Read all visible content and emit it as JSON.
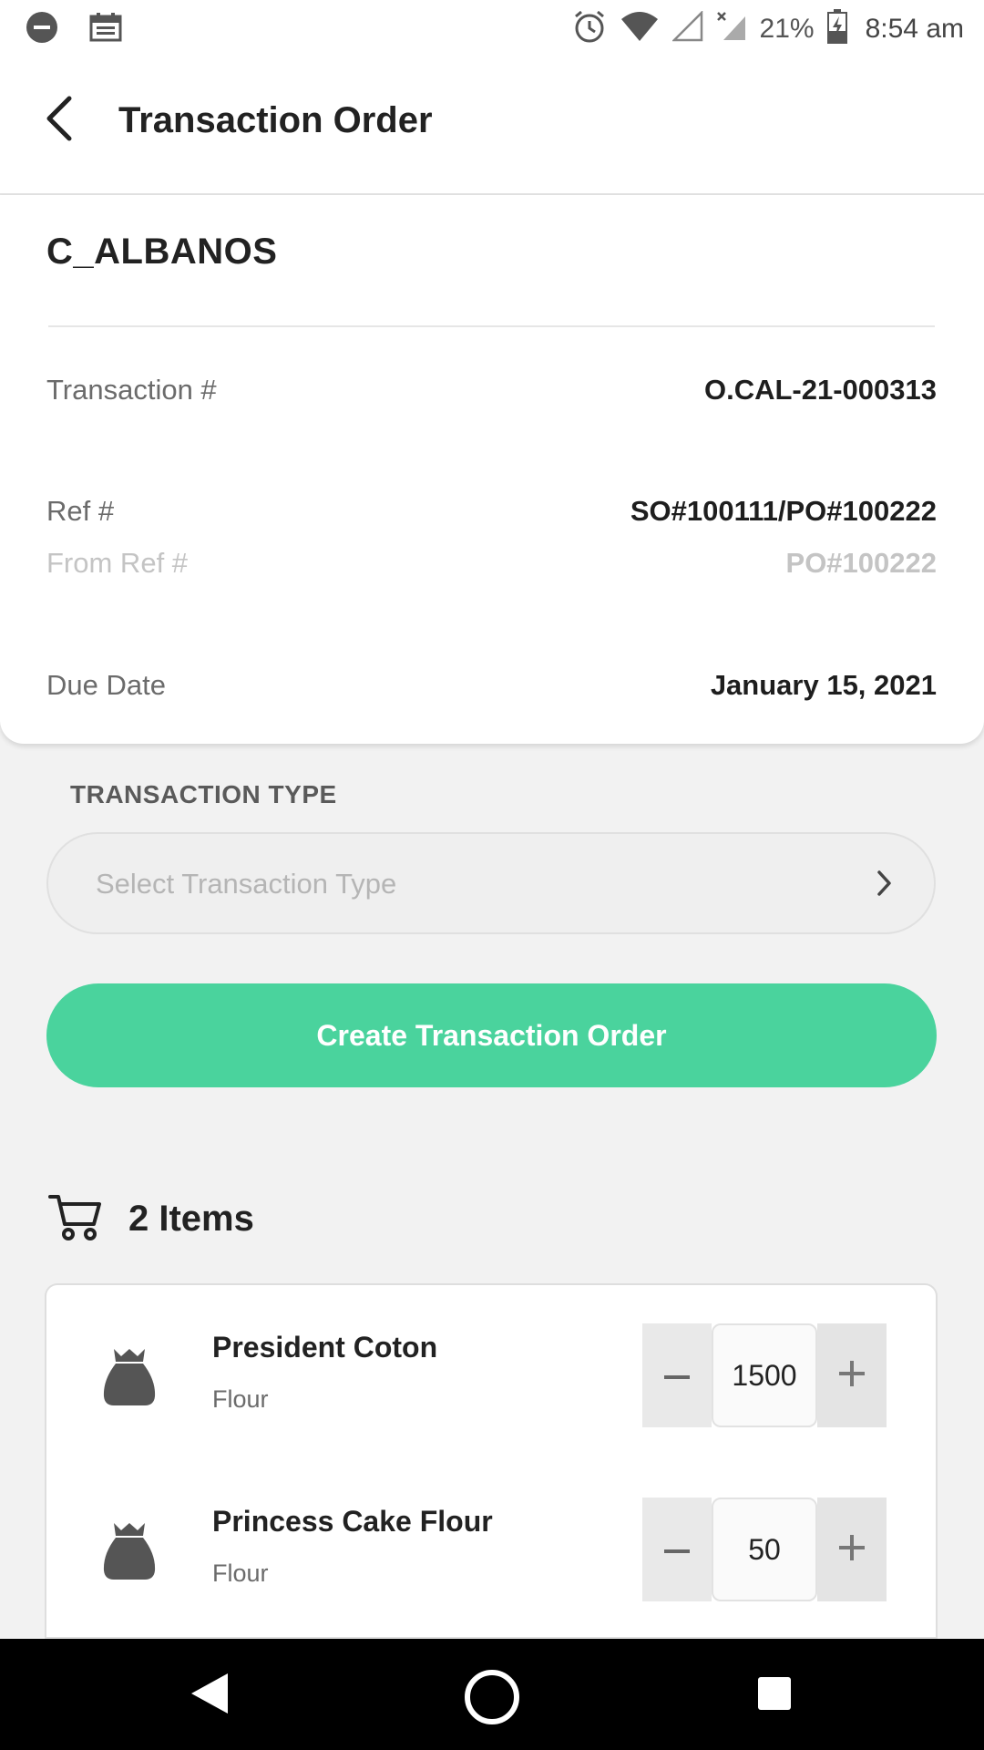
{
  "status_bar": {
    "battery": "21%",
    "time": "8:54 am",
    "icons": [
      "dnd-icon",
      "calendar-icon",
      "alarm-icon",
      "wifi-icon",
      "signal-icon",
      "no-signal-icon",
      "battery-charging-icon"
    ]
  },
  "app_bar": {
    "title": "Transaction Order",
    "back_icon": "back-arrow-icon"
  },
  "order": {
    "customer": "C_ALBANOS",
    "transaction_label": "Transaction #",
    "transaction_value": "O.CAL-21-000313",
    "ref_label": "Ref #",
    "ref_value": "SO#100111/PO#100222",
    "from_ref_label": "From Ref #",
    "from_ref_value": "PO#100222",
    "due_date_label": "Due Date",
    "due_date_value": "January 15, 2021"
  },
  "transaction_type": {
    "label": "TRANSACTION TYPE",
    "placeholder": "Select Transaction Type"
  },
  "create_button": "Create Transaction Order",
  "items_header": {
    "count_label": "2 Items"
  },
  "items": [
    {
      "name": "President Coton",
      "category": "Flour",
      "quantity": "1500"
    },
    {
      "name": "Princess Cake Flour",
      "category": "Flour",
      "quantity": "50"
    }
  ],
  "colors": {
    "accent": "#4ad39d",
    "background": "#f2f2f2",
    "card": "#ffffff",
    "text": "#222222"
  }
}
